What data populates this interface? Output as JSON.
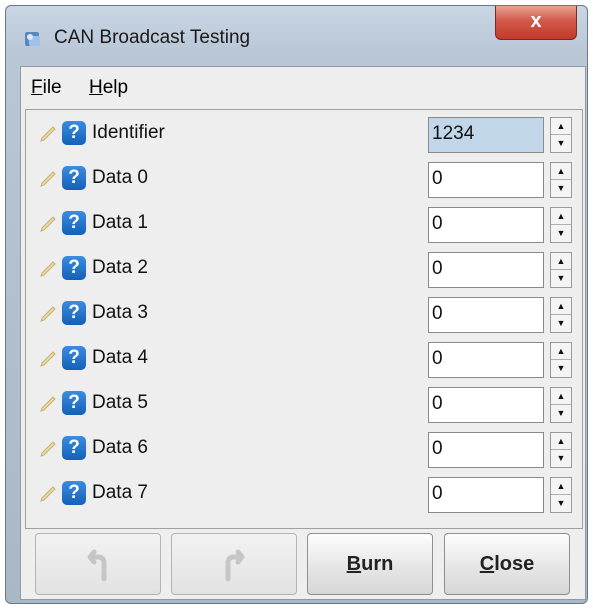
{
  "window": {
    "title": "CAN Broadcast Testing",
    "close_label": "x"
  },
  "menu": {
    "file": {
      "label": "File",
      "mnemonic": "F",
      "rest": "ile"
    },
    "help": {
      "label": "Help",
      "mnemonic": "H",
      "rest": "elp"
    }
  },
  "rows": [
    {
      "label": "Identifier",
      "value": "1234"
    },
    {
      "label": "Data 0",
      "value": "0"
    },
    {
      "label": "Data 1",
      "value": "0"
    },
    {
      "label": "Data 2",
      "value": "0"
    },
    {
      "label": "Data 3",
      "value": "0"
    },
    {
      "label": "Data 4",
      "value": "0"
    },
    {
      "label": "Data 5",
      "value": "0"
    },
    {
      "label": "Data 6",
      "value": "0"
    },
    {
      "label": "Data 7",
      "value": "0"
    }
  ],
  "help_glyph": "?",
  "buttons": {
    "undo": {
      "icon": "undo-icon",
      "enabled": false
    },
    "redo": {
      "icon": "redo-icon",
      "enabled": false
    },
    "burn": {
      "label": "Burn",
      "mnemonic": "B",
      "rest": "urn"
    },
    "close": {
      "label": "Close",
      "mnemonic": "C",
      "rest": "lose"
    }
  },
  "colors": {
    "close_button": "#c8412f",
    "help_icon": "#1f6fc8",
    "selected_field": "#c2d6ea"
  }
}
